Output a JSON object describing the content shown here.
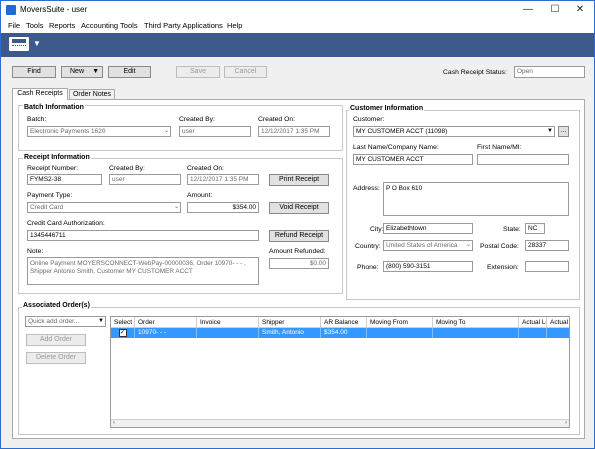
{
  "app": {
    "title": "MoversSuite - user"
  },
  "window_controls": {
    "minimize": "—",
    "maximize": "☐",
    "close": "✕"
  },
  "menu": [
    "File",
    "Tools",
    "Reports",
    "Accounting Tools",
    "Third Party Applications",
    "Help"
  ],
  "actions": {
    "find": "Find",
    "new": "New",
    "edit": "Edit",
    "save": "Save",
    "cancel": "Cancel"
  },
  "status": {
    "label": "Cash Receipt Status:",
    "value": "Open"
  },
  "tabs": [
    "Cash Receipts",
    "Order Notes"
  ],
  "batch": {
    "heading": "Batch Information",
    "batch_label": "Batch:",
    "batch_value": "Electronic Payments 1620",
    "created_by_label": "Created By:",
    "created_by_value": "user",
    "created_on_label": "Created On:",
    "created_on_value": "12/12/2017 1:35 PM"
  },
  "receipt": {
    "heading": "Receipt Information",
    "number_label": "Receipt Number:",
    "number_value": "FYMS2-38",
    "created_by_label": "Created By:",
    "created_by_value": "user",
    "created_on_label": "Created On:",
    "created_on_value": "12/12/2017 1:35 PM",
    "payment_type_label": "Payment Type:",
    "payment_type_value": "Credit Card",
    "amount_label": "Amount:",
    "amount_value": "$354.00",
    "cc_auth_label": "Credit Card Authorization:",
    "cc_auth_value": "1345446711",
    "note_label": "Note:",
    "note_value": "Online Payment MOYERSCONNECT-WebPay-00000036, Order 10970- - - , Shipper Antonio Smith, Customer MY CUSTOMER ACCT",
    "refunded_label": "Amount Refunded:",
    "refunded_value": "$0.00",
    "print_button": "Print Receipt",
    "void_button": "Void Receipt",
    "refund_button": "Refund Receipt"
  },
  "customer": {
    "heading": "Customer Information",
    "customer_label": "Customer:",
    "customer_value": "MY CUSTOMER ACCT (11098)",
    "lastname_label": "Last Name/Company Name:",
    "lastname_value": "MY CUSTOMER ACCT",
    "firstname_label": "First Name/MI:",
    "firstname_value": "",
    "address_label": "Address:",
    "address_value": "P O Box 610",
    "city_label": "City:",
    "city_value": "Elizabethtown",
    "state_label": "State:",
    "state_value": "NC",
    "country_label": "Country:",
    "country_value": "United States of America",
    "postal_label": "Postal Code:",
    "postal_value": "28337",
    "phone_label": "Phone:",
    "phone_value": "(800) 590-3151",
    "ext_label": "Extension:",
    "ext_value": "",
    "more_button": "..."
  },
  "orders": {
    "heading": "Associated Order(s)",
    "quick_add_placeholder": "Quick add order...",
    "add_button": "Add Order",
    "delete_button": "Delete Order",
    "columns": [
      "Select",
      "Order",
      "Invoice",
      "Shipper",
      "AR Balance",
      "Moving From",
      "Moving To",
      "Actual Load",
      "Actual"
    ],
    "rows": [
      {
        "select": "✓",
        "order": "10970- - -",
        "invoice": "",
        "shipper": "Smith, Antonio",
        "ar_balance": "$354.00",
        "moving_from": "",
        "moving_to": "",
        "actual_load": "",
        "actual": ""
      }
    ]
  },
  "icons": {
    "app": "moverssuite-app-icon",
    "toolbar": "cash-register-icon",
    "dropdown": "chevron-down-icon"
  }
}
